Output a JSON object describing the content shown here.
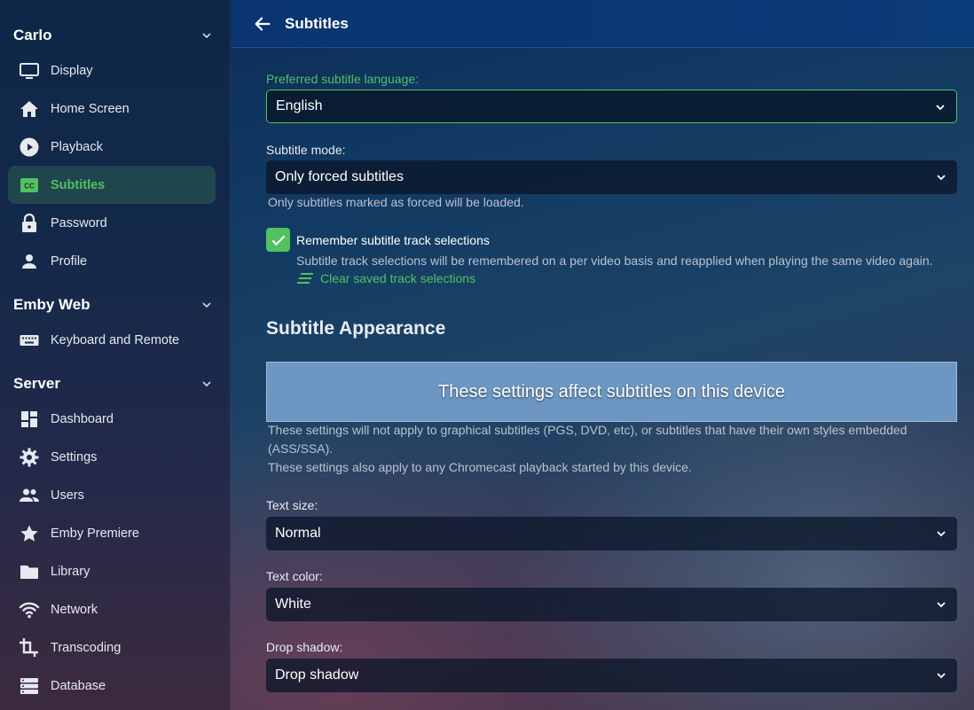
{
  "sidebar": {
    "sections": [
      {
        "title": "Carlo",
        "items": [
          {
            "label": "Display",
            "icon": "monitor-icon"
          },
          {
            "label": "Home Screen",
            "icon": "home-icon"
          },
          {
            "label": "Playback",
            "icon": "play-circle-icon"
          },
          {
            "label": "Subtitles",
            "icon": "closed-caption-icon",
            "active": true
          },
          {
            "label": "Password",
            "icon": "lock-icon"
          },
          {
            "label": "Profile",
            "icon": "person-icon"
          }
        ]
      },
      {
        "title": "Emby Web",
        "items": [
          {
            "label": "Keyboard and Remote",
            "icon": "keyboard-icon"
          }
        ]
      },
      {
        "title": "Server",
        "items": [
          {
            "label": "Dashboard",
            "icon": "dashboard-icon"
          },
          {
            "label": "Settings",
            "icon": "gear-icon"
          },
          {
            "label": "Users",
            "icon": "users-icon"
          },
          {
            "label": "Emby Premiere",
            "icon": "star-icon"
          },
          {
            "label": "Library",
            "icon": "folder-icon"
          },
          {
            "label": "Network",
            "icon": "wifi-icon"
          },
          {
            "label": "Transcoding",
            "icon": "crop-icon"
          },
          {
            "label": "Database",
            "icon": "database-icon"
          }
        ]
      }
    ]
  },
  "header": {
    "title": "Subtitles"
  },
  "form": {
    "preferred_language": {
      "label": "Preferred subtitle language:",
      "value": "English"
    },
    "subtitle_mode": {
      "label": "Subtitle mode:",
      "value": "Only forced subtitles",
      "help": "Only subtitles marked as forced will be loaded."
    },
    "remember": {
      "label": "Remember subtitle track selections",
      "checked": true,
      "help": "Subtitle track selections will be remembered on a per video basis and reapplied when playing the same video again.",
      "clear_link": "Clear saved track selections"
    },
    "appearance": {
      "heading": "Subtitle Appearance",
      "preview_text": "These settings affect subtitles on this device",
      "help_line1": "These settings will not apply to graphical subtitles (PGS, DVD, etc), or subtitles that have their own styles embedded (ASS/SSA).",
      "help_line2": "These settings also apply to any Chromecast playback started by this device."
    },
    "text_size": {
      "label": "Text size:",
      "value": "Normal"
    },
    "text_color": {
      "label": "Text color:",
      "value": "White"
    },
    "drop_shadow": {
      "label": "Drop shadow:",
      "value": "Drop shadow"
    }
  },
  "colors": {
    "accent": "#52c160",
    "preview_bg": "#6d97c2"
  }
}
